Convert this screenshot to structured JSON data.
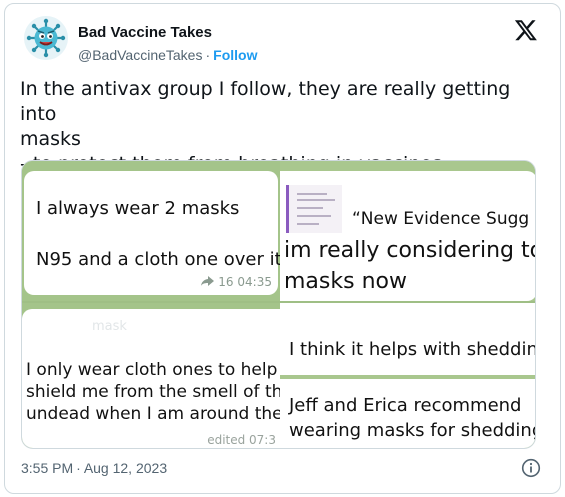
{
  "author": {
    "name": "Bad Vaccine Takes",
    "handle": "@BadVaccineTakes",
    "separator": "·",
    "follow_label": "Follow"
  },
  "tweet": {
    "text": "In the antivax group I follow, they are really getting into\nmasks\n- to protect them from breathing in vaccines"
  },
  "media": {
    "panel1": {
      "line1": "I always wear 2 masks",
      "line2": "N95 and a cloth one over it",
      "forwards": "16",
      "time": "04:35"
    },
    "panel2": {
      "quote": "“New Evidence Sugg",
      "line1": "im really considering to",
      "line2": "masks now"
    },
    "panel3": {
      "faint": "mask",
      "text": "I only wear cloth ones to help\nshield me from the smell of the\nundead when I am around them",
      "meta": "edited 07:3"
    },
    "panel4": {
      "line1": "I think it helps with shedding",
      "line2": "Jeff and Erica recommend\nwearing masks for shedding"
    }
  },
  "footer": {
    "time": "3:55 PM",
    "separator": "·",
    "date": "Aug 12, 2023"
  },
  "colors": {
    "accent": "#1d9bf0",
    "text": "#0f1419",
    "muted": "#536471",
    "chat_background": "#a4c48a"
  },
  "icons": [
    "virus-avatar-icon",
    "x-logo-icon",
    "forward-icon",
    "info-icon"
  ]
}
